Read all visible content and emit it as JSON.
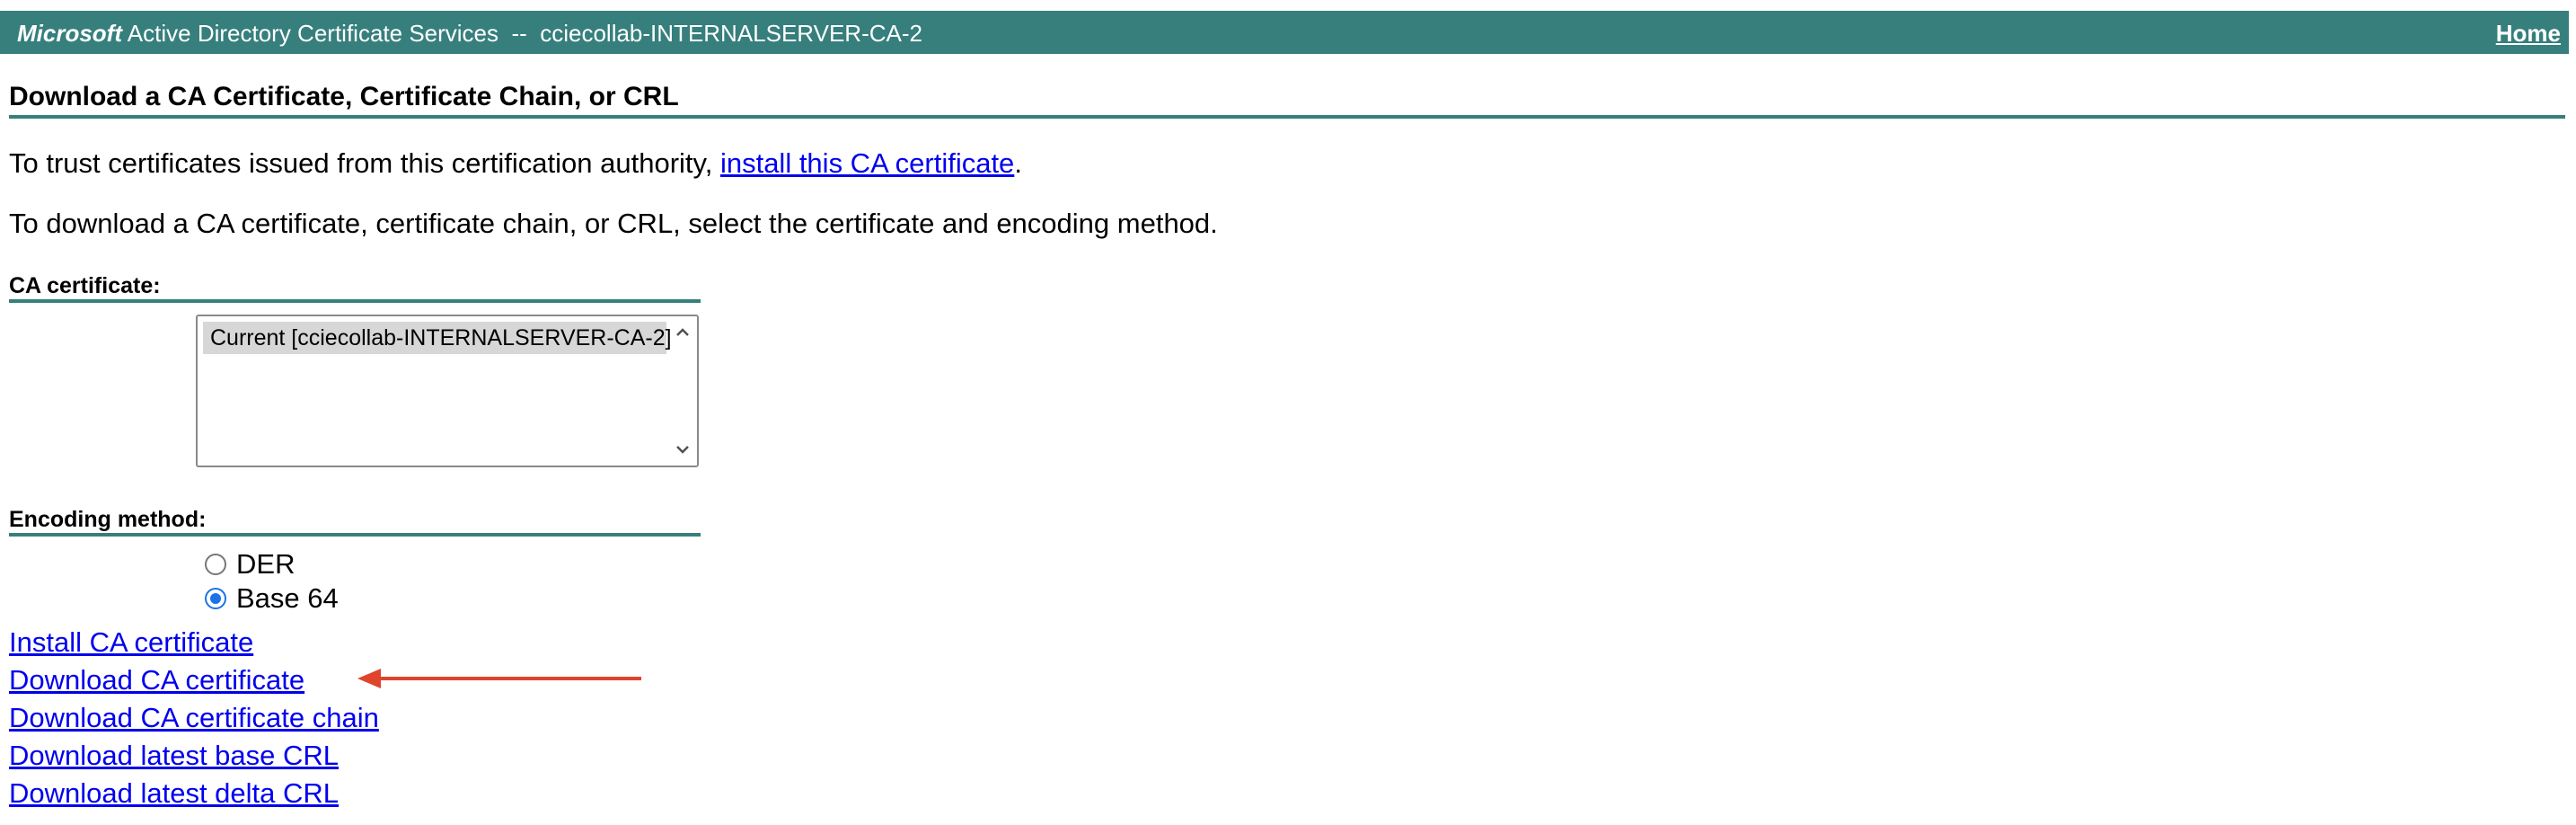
{
  "header": {
    "brand_bold": "Microsoft",
    "brand_rest": " Active Directory Certificate Services  --  cciecollab-INTERNALSERVER-CA-2",
    "home_link": "Home"
  },
  "page_title": "Download a CA Certificate, Certificate Chain, or CRL",
  "trust_paragraph": {
    "text": "To trust certificates issued from this certification authority, ",
    "link": "install this CA certificate",
    "suffix": "."
  },
  "instructions": "To download a CA certificate, certificate chain, or CRL, select the certificate and encoding method.",
  "ca_certificate": {
    "label": "CA certificate:",
    "options": [
      "Current [cciecollab-INTERNALSERVER-CA-2]"
    ],
    "selected": "Current [cciecollab-INTERNALSERVER-CA-2]"
  },
  "encoding": {
    "label": "Encoding method:",
    "options": [
      {
        "label": "DER",
        "checked": false
      },
      {
        "label": "Base 64",
        "checked": true
      }
    ]
  },
  "actions": [
    {
      "label": "Install CA certificate"
    },
    {
      "label": "Download CA certificate"
    },
    {
      "label": "Download CA certificate chain"
    },
    {
      "label": "Download latest base CRL"
    },
    {
      "label": "Download latest delta CRL"
    }
  ],
  "colors": {
    "header_bg": "#367f7d",
    "link": "#0000ee",
    "annotation_arrow": "#e0442d",
    "radio_accent": "#1a73e8"
  },
  "icons": {
    "scroll_up": "chevron-up-icon",
    "scroll_down": "chevron-down-icon",
    "annotation": "red-arrow-icon"
  }
}
